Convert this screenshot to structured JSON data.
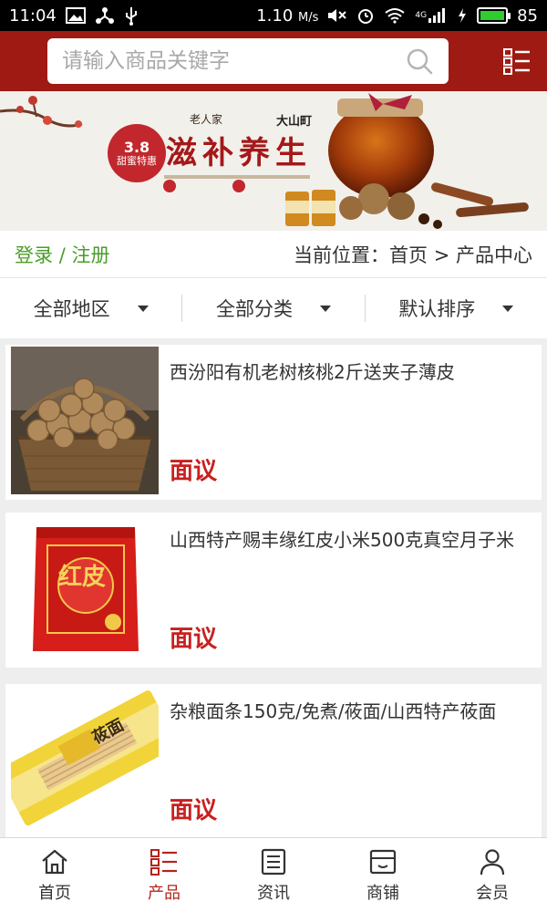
{
  "status": {
    "time": "11:04",
    "speed": "1.10",
    "speed_unit": "M/s",
    "network": "4G",
    "battery": "85"
  },
  "search": {
    "placeholder": "请输入商品关键字"
  },
  "banner": {
    "badge_top": "3.8",
    "badge_bottom": "甜蜜特惠",
    "brand_small": "老人家",
    "headline": "滋补养生",
    "brand": "大山町"
  },
  "breadcrumb": {
    "login": "登录",
    "separator": "/",
    "register": "注册",
    "location": "当前位置：首页 > 产品中心"
  },
  "filters": [
    {
      "label": "全部地区"
    },
    {
      "label": "全部分类"
    },
    {
      "label": "默认排序"
    }
  ],
  "products": [
    {
      "title": "西汾阳有机老树核桃2斤送夹子薄皮",
      "price": "面议"
    },
    {
      "title": "山西特产赐丰缘红皮小米500克真空月子米",
      "price": "面议",
      "package_text": "红皮"
    },
    {
      "title": "杂粮面条150克/免煮/莜面/山西特产莜面",
      "price": "面议",
      "package_text": "莜面"
    }
  ],
  "tabs": [
    {
      "label": "首页",
      "icon": "home-icon"
    },
    {
      "label": "产品",
      "icon": "grid-list-icon"
    },
    {
      "label": "资讯",
      "icon": "news-icon"
    },
    {
      "label": "商铺",
      "icon": "shop-icon"
    },
    {
      "label": "会员",
      "icon": "user-icon"
    }
  ],
  "colors": {
    "header": "#9e1a12",
    "accent": "#b5231b",
    "price": "#c8201f",
    "login": "#4a9d2a"
  }
}
